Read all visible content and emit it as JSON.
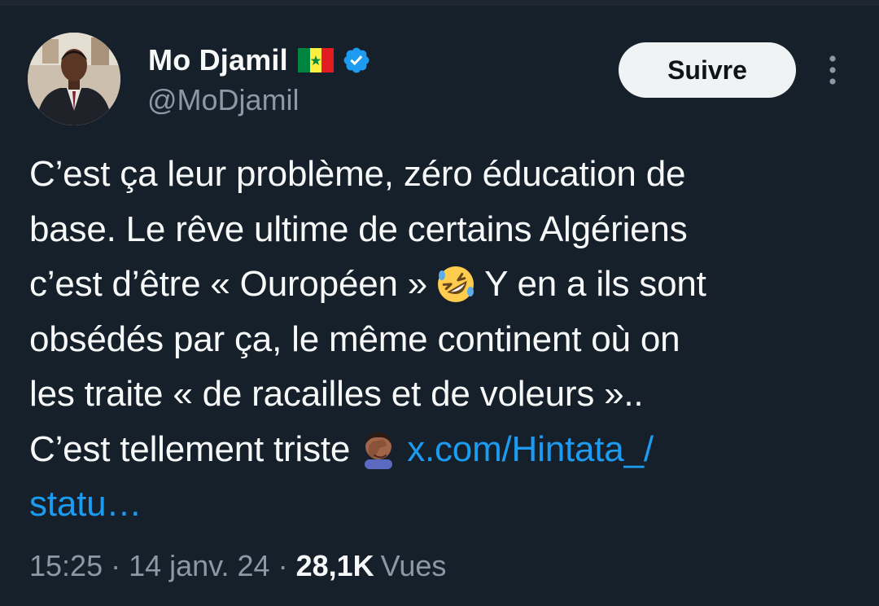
{
  "author": {
    "display_name": "Mo Djamil",
    "handle": "@MoDjamil",
    "flag_icon": "senegal-flag-icon",
    "verified_icon": "verified-badge-icon",
    "verified_color": "#1d9bf0"
  },
  "header": {
    "follow_label": "Suivre",
    "more_icon": "more-vertical-icon"
  },
  "tweet": {
    "line1": "C’est ça leur problème, zéro éducation de",
    "line2": "base. Le rêve ultime de certains Algériens",
    "line3_before": "c’est d’être « Ouropéen »",
    "line3_emoji": "rolling-on-floor-laughing-emoji",
    "line3_after": "Y en a ils sont",
    "line4": "obsédés par ça, le même continent où on",
    "line5": "les traite « de racailles et de voleurs »..",
    "line6_before": "C’est tellement triste",
    "line6_emoji": "facepalm-emoji",
    "link_part1": "x.com/Hintata_/",
    "link_part2": "statu…"
  },
  "meta": {
    "time": "15:25",
    "separator1": "·",
    "date": "14 janv. 24",
    "separator2": "·",
    "views_count": "28,1K",
    "views_label": "Vues"
  },
  "colors": {
    "background": "#15202b",
    "text": "#f7f9f9",
    "secondary_text": "#8b98a5",
    "link": "#1d9bf0",
    "button_bg": "#eff3f4"
  }
}
